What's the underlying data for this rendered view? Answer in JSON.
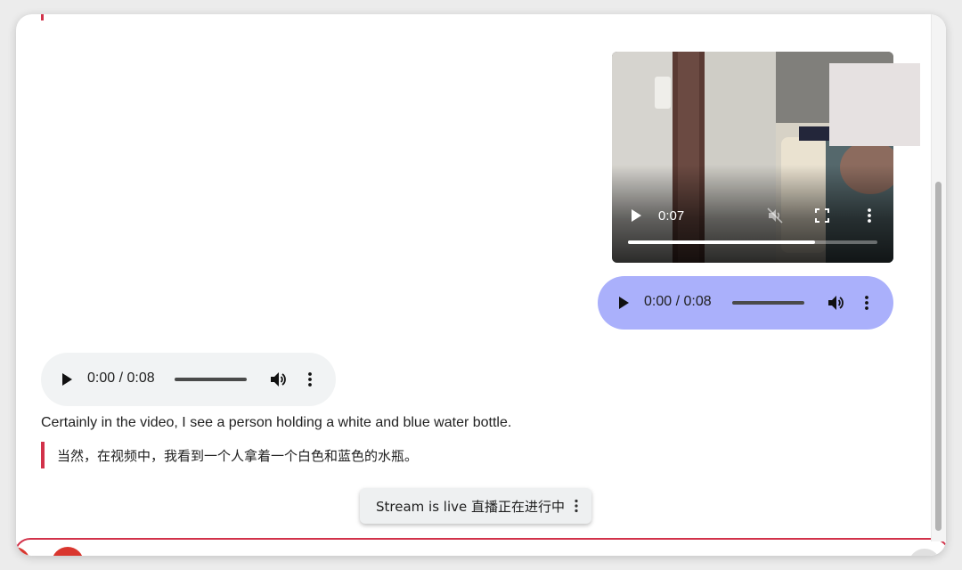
{
  "video": {
    "current_time": "0:07",
    "progress": 0.75
  },
  "user_audio": {
    "time": "0:00 / 0:08",
    "background": "#aab0fb"
  },
  "ai_audio": {
    "time": "0:00 / 0:08",
    "background": "#f1f3f4"
  },
  "reply": {
    "text": "Certainly in the video, I see a person holding a white and blue water bottle.",
    "translation": "当然，在视频中，我看到一个人拿着一个白色和蓝色的水瓶。"
  },
  "toast": {
    "label": "Stream is live 直播正在进行中"
  },
  "colors": {
    "accent": "#d2324a",
    "record_button": "#d9362e"
  },
  "icons": [
    "play-icon",
    "mute-icon",
    "volume-icon",
    "fullscreen-icon",
    "more-vert-icon"
  ]
}
